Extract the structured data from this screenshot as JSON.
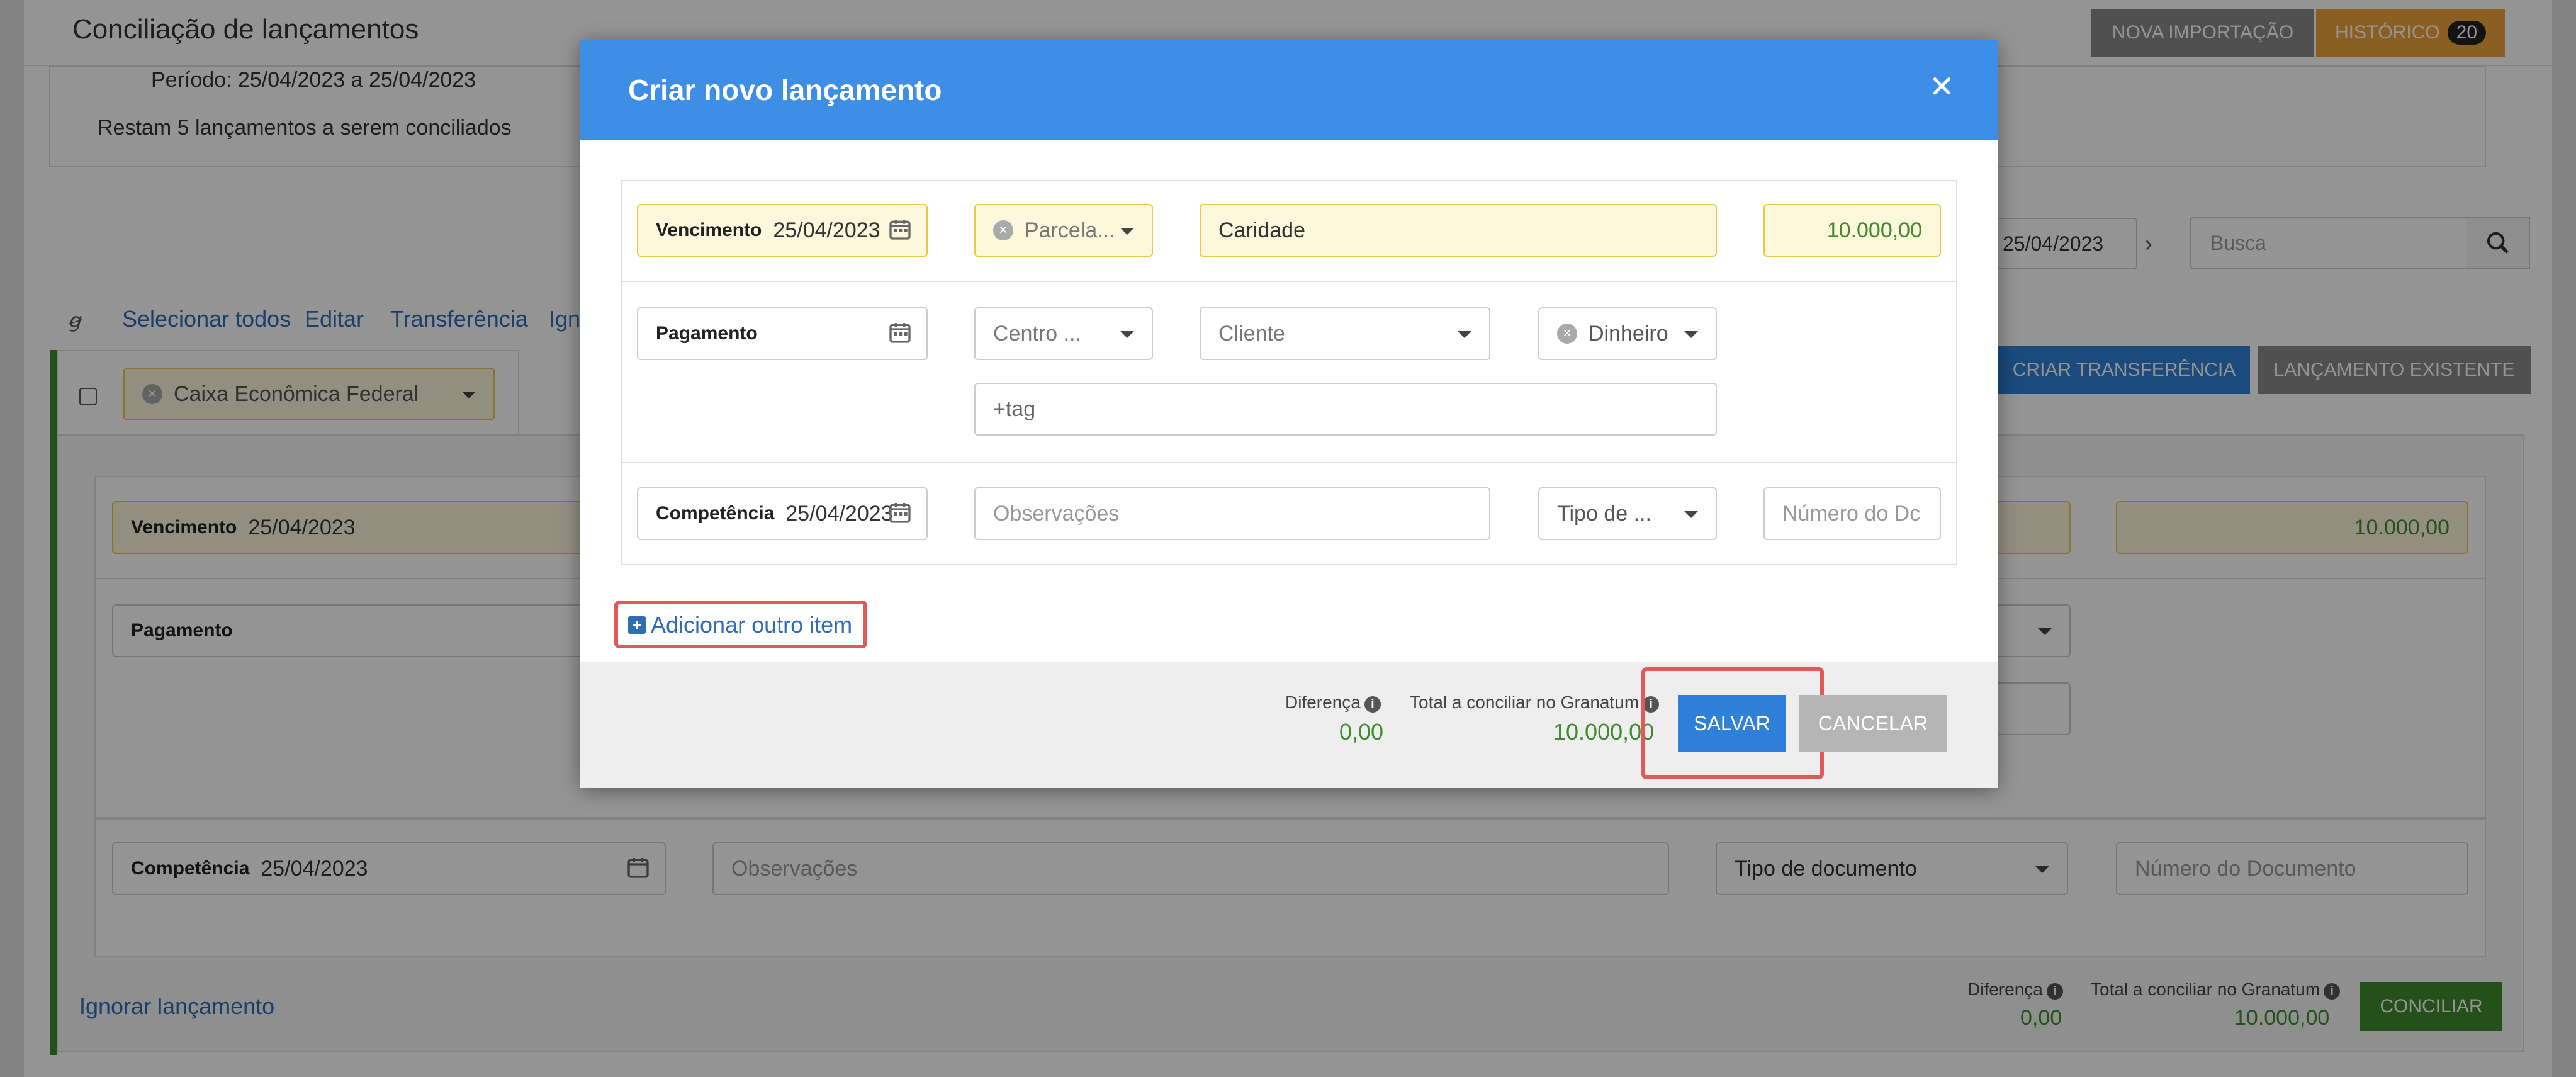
{
  "page": {
    "title": "Conciliação de lançamentos",
    "nova_importacao": "NOVA IMPORTAÇÃO",
    "historico": "HISTÓRICO",
    "historico_count": "20",
    "periodo": "Período: 25/04/2023 a 25/04/2023",
    "restam": "Restam 5 lançamentos a serem conciliados",
    "date_filter": "25/04/2023",
    "search_placeholder": "Busca",
    "actions": {
      "selecionar": "Selecionar todos",
      "editar": "Editar",
      "transferencia": "Transferência",
      "ignorar_partial": "Igno"
    },
    "criar_transferencia": "CRIAR TRANSFERÊNCIA",
    "lancamento_existente": "LANÇAMENTO EXISTENTE",
    "account": "Caixa Econômica Federal",
    "vencimento_label": "Vencimento",
    "vencimento_value": "25/04/2023",
    "amount": "10.000,00",
    "pagamento_label": "Pagamento",
    "competencia_label": "Competência",
    "competencia_value": "25/04/2023",
    "observacoes_placeholder": "Observações",
    "tipo_documento": "Tipo de documento",
    "numero_documento_placeholder": "Número do Documento",
    "ignorar_lancamento": "Ignorar lançamento",
    "diferenca_label": "Diferença",
    "diferenca_value": "0,00",
    "total_label": "Total a conciliar no Granatum",
    "total_value": "10.000,00",
    "conciliar": "CONCILIAR"
  },
  "modal": {
    "title": "Criar novo lançamento",
    "close": "×",
    "vencimento_label": "Vencimento",
    "vencimento_value": "25/04/2023",
    "parcela": "Parcela...",
    "descricao": "Caridade",
    "valor": "10.000,00",
    "pagamento_label": "Pagamento",
    "centro": "Centro ...",
    "cliente": "Cliente",
    "forma_pagamento": "Dinheiro",
    "tag_placeholder": "+tag",
    "competencia_label": "Competência",
    "competencia_value": "25/04/2023",
    "observacoes_placeholder": "Observações",
    "tipo": "Tipo de ...",
    "numero_placeholder": "Número do Dc",
    "adicionar": "Adicionar outro item",
    "diferenca_label": "Diferença",
    "diferenca_value": "0,00",
    "total_label": "Total a conciliar no Granatum",
    "total_value": "10.000,00",
    "salvar": "SALVAR",
    "cancelar": "CANCELAR"
  },
  "colors": {
    "header_blue": "#3e8ee6",
    "save_blue": "#2f80d8",
    "highlight_red": "#e05a5a",
    "value_green": "#3f8a2c",
    "warning_yellow": "#fdf7dc"
  }
}
